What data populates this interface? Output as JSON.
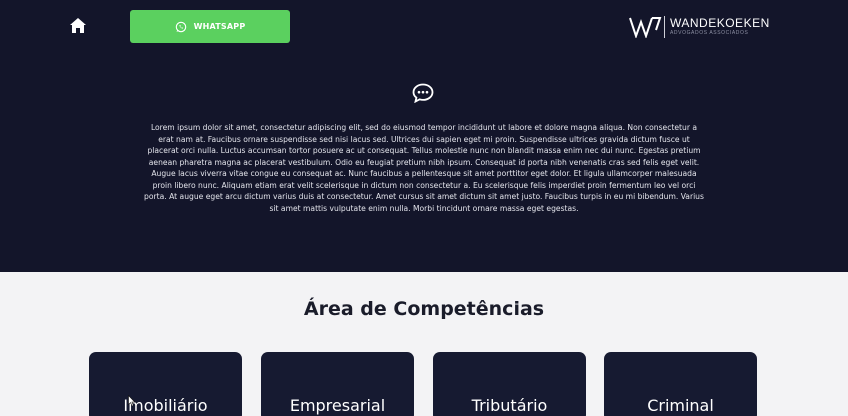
{
  "header": {
    "home_icon": "home-icon",
    "whatsapp_label": "WHATSAPP",
    "whatsapp_icon": "whatsapp-icon",
    "whatsapp_color": "#5bd05f",
    "logo_name": "WANDEKOEKEN",
    "logo_sub": "ADVOGADOS ASSOCIADOS"
  },
  "hero": {
    "background": "#13152a",
    "icon": "chat-bubble-icon",
    "text": "Lorem ipsum dolor sit amet, consectetur adipiscing elit, sed do eiusmod tempor incididunt ut labore et dolore magna aliqua. Non consectetur a erat nam at. Faucibus ornare suspendisse sed nisi lacus sed. Ultrices dui sapien eget mi proin. Suspendisse ultrices gravida dictum fusce ut placerat orci nulla. Luctus accumsan tortor posuere ac ut consequat. Tellus molestie nunc non blandit massa enim nec dui nunc. Egestas pretium aenean pharetra magna ac placerat vestibulum. Odio eu feugiat pretium nibh ipsum. Consequat id porta nibh venenatis cras sed felis eget velit. Augue lacus viverra vitae congue eu consequat ac. Nunc faucibus a pellentesque sit amet porttitor eget dolor. Et ligula ullamcorper malesuada proin libero nunc. Aliquam etiam erat velit scelerisque in dictum non consectetur a. Eu scelerisque felis imperdiet proin fermentum leo vel orci porta. At augue eget arcu dictum varius duis at consectetur. Amet cursus sit amet dictum sit amet justo. Faucibus turpis in eu mi bibendum. Varius sit amet mattis vulputate enim nulla. Morbi tincidunt ornare massa eget egestas."
  },
  "competencias": {
    "title": "Área de Competências",
    "cards": [
      {
        "label": "Imobiliário"
      },
      {
        "label": "Empresarial"
      },
      {
        "label": "Tributário"
      },
      {
        "label": "Criminal"
      }
    ]
  }
}
